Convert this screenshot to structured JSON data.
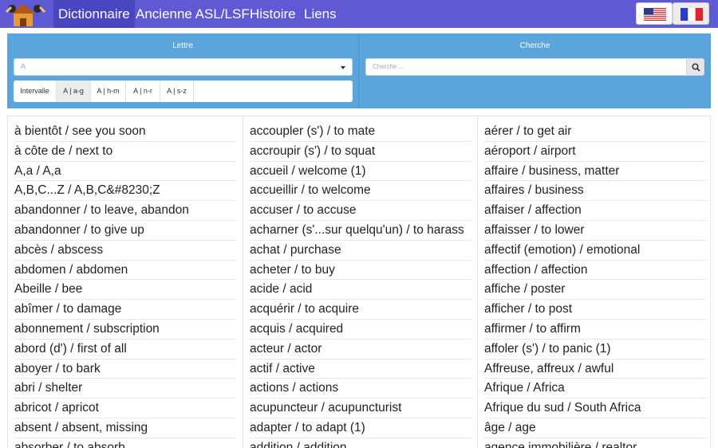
{
  "nav": {
    "items": [
      "Dictionnaire",
      "Ancienne ASL/LSF",
      "Histoire",
      "Liens"
    ],
    "active_index": 0,
    "languages": [
      "en-us",
      "fr"
    ],
    "selected_language": "fr"
  },
  "colors": {
    "nav_bg": "#5f5ad3",
    "panel_bg": "#5aa6dc"
  },
  "filters": {
    "letter_label": "Lettre",
    "search_label": "Cherche",
    "letter_value": "A",
    "search_placeholder": "Cherche ...",
    "ranges": [
      "Intervalle",
      "A | a-g",
      "A | h-m",
      "A | n-r",
      "A | s-z"
    ],
    "active_range_index": 1
  },
  "entries": {
    "column1": [
      "à bientôt / see you soon",
      "à côte de / next to",
      "A,a / A,a",
      "A,B,C...Z / A,B,C&#8230;Z",
      "abandonner / to leave, abandon",
      "abandonner / to give up",
      "abcès / abscess",
      "abdomen / abdomen",
      "Abeille / bee",
      "abîmer / to damage",
      "abonnement / subscription",
      "abord (d') / first of all",
      "aboyer / to bark",
      "abri / shelter",
      "abricot / apricot",
      "absent / absent, missing",
      "absorber / to absorb"
    ],
    "column2": [
      "accoupler (s') / to mate",
      "accroupir (s') / to squat",
      "accueil / welcome (1)",
      "accueillir / to welcome",
      "accuser / to accuse",
      "acharner (s'...sur quelqu'un) / to harass",
      "achat / purchase",
      "acheter / to buy",
      "acide / acid",
      "acquérir / to acquire",
      "acquis / acquired",
      "acteur / actor",
      "actif / active",
      "actions / actions",
      "acupuncteur / acupuncturist",
      "adapter / to adapt (1)",
      "addition / addition"
    ],
    "column3": [
      "aérer / to get air",
      "aéroport / airport",
      "affaire / business, matter",
      "affaires / business",
      "affaiser / affection",
      "affaisser / to lower",
      "affectif (emotion) / emotional",
      "affection / affection",
      "affiche / poster",
      "afficher / to post",
      "affirmer / to affirm",
      "affoler (s') / to panic (1)",
      "Affreuse, affreux / awful",
      "Afrique / Africa",
      "Afrique du sud / South Africa",
      "âge / age",
      "agence immobilière / realtor"
    ]
  }
}
